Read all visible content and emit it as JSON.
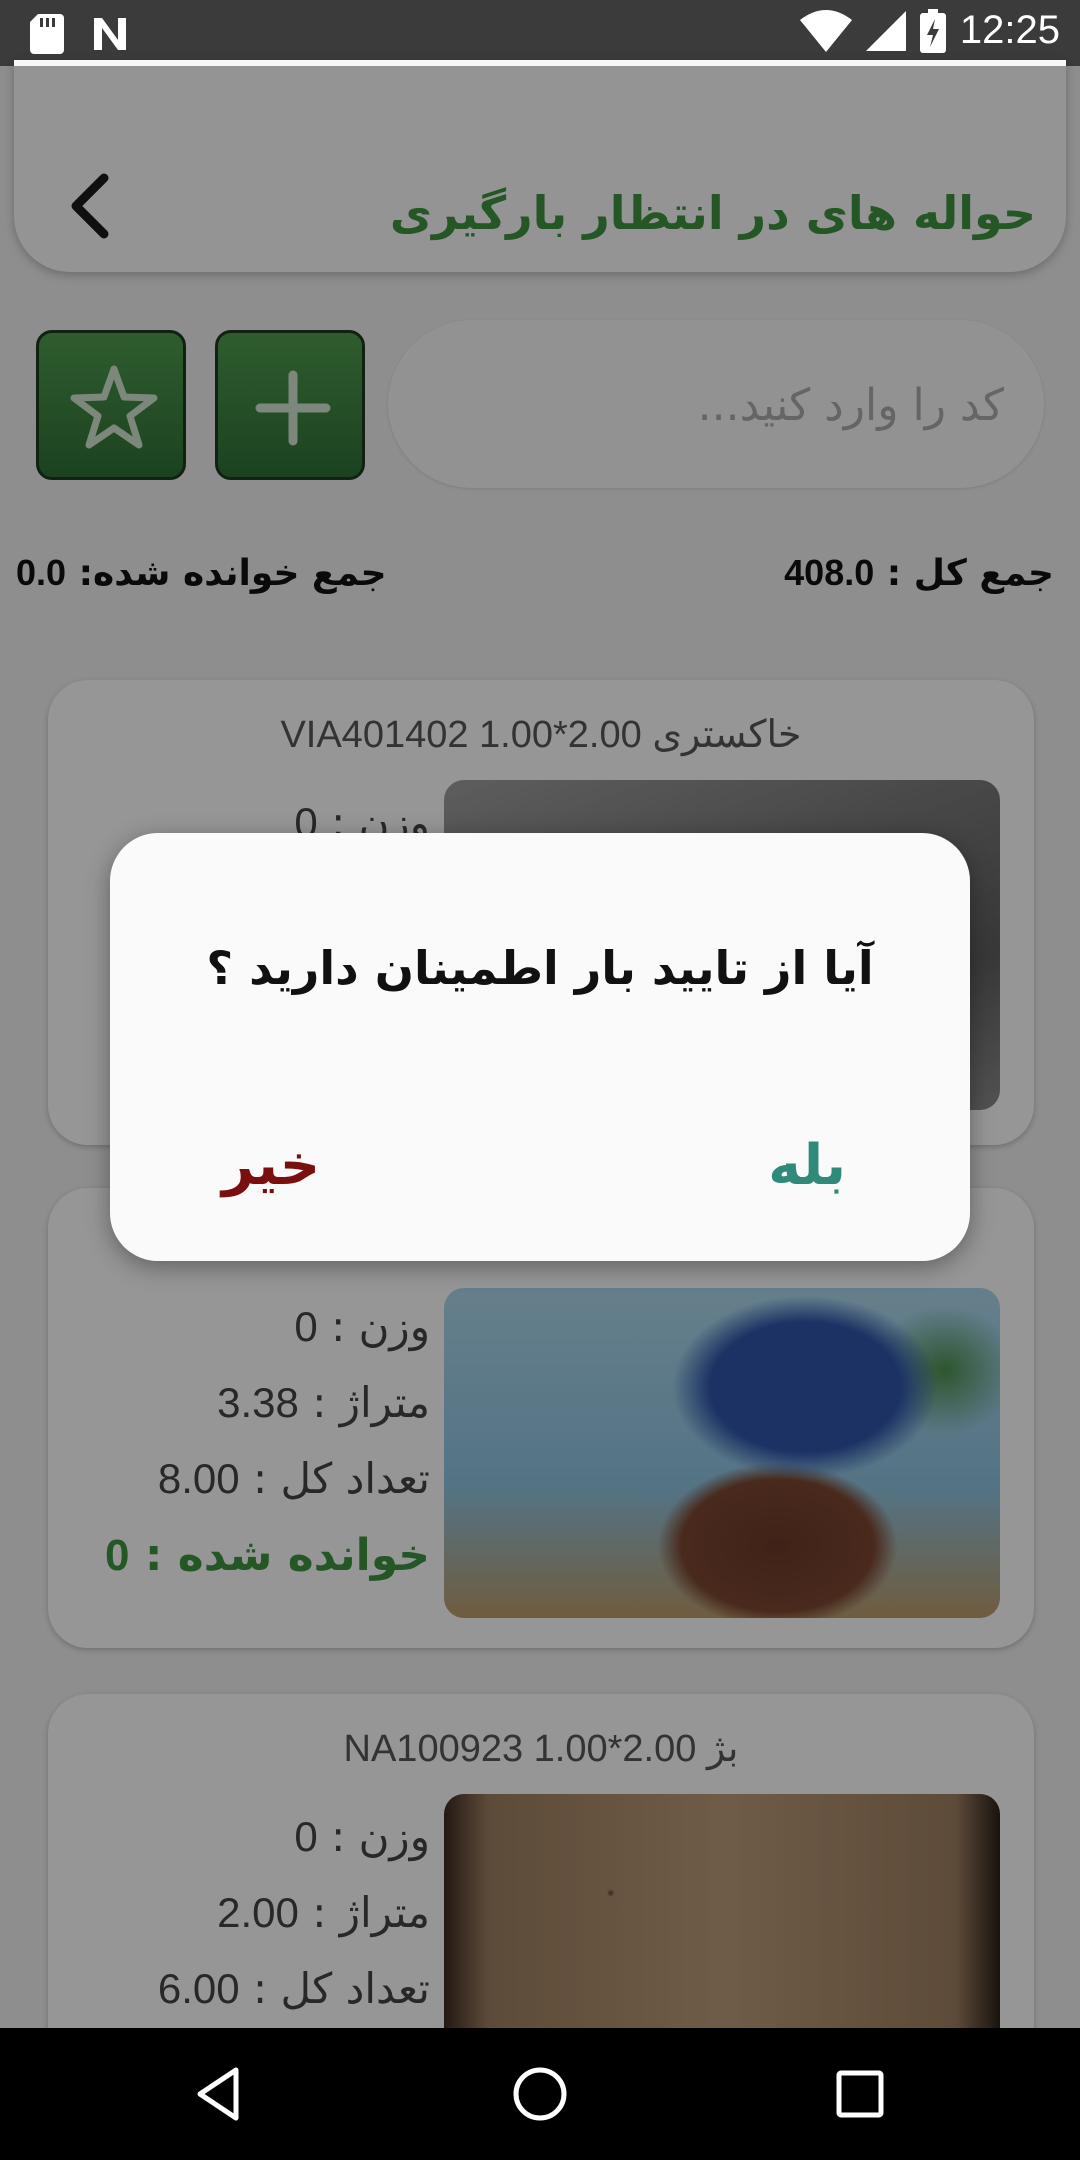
{
  "status_bar": {
    "time": "12:25",
    "icons": [
      "sd-card-icon",
      "n-app-icon",
      "wifi-icon",
      "cell-signal-icon",
      "battery-charging-icon"
    ]
  },
  "header": {
    "title": "حواله های در انتظار بارگیری",
    "back_icon": "chevron-left-icon",
    "title_color": "#3e8f3e"
  },
  "toolbar": {
    "search_placeholder": "کد را وارد کنید...",
    "star_icon": "star-icon",
    "plus_icon": "plus-icon",
    "button_color": "#3f8a44"
  },
  "totals": {
    "total_label": "جمع کل :",
    "total_value": "408.0",
    "read_label": "جمع خوانده شده:",
    "read_value": "0.0"
  },
  "cards": [
    {
      "title": "VIA401402 1.00*2.00 خاکستری",
      "weight_label": "وزن :",
      "weight": "0"
    },
    {
      "weight_label": "وزن :",
      "weight": "0",
      "area_label": "متراژ :",
      "area": "3.38",
      "count_label": "تعداد کل :",
      "count": "8.00",
      "read_label": "خوانده شده :",
      "read": "0"
    },
    {
      "title": "NA100923 1.00*2.00 بژ",
      "weight_label": "وزن :",
      "weight": "0",
      "area_label": "متراژ :",
      "area": "2.00",
      "count_label": "تعداد کل :",
      "count": "6.00"
    }
  ],
  "dialog": {
    "message": "آیا از تایید بار اطمینان دارید ؟",
    "yes_label": "بله",
    "no_label": "خیر",
    "yes_color": "#2f8a7a",
    "no_color": "#7a0f10"
  },
  "nav_bar": {
    "icons": [
      "back-triangle-icon",
      "home-circle-icon",
      "recents-square-icon"
    ]
  }
}
